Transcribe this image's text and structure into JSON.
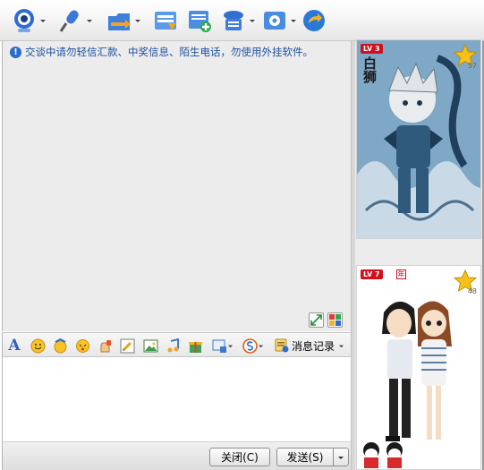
{
  "notice": {
    "text": "交谈中请勿轻信汇款、中奖信息、陌生电话，勿使用外挂软件。"
  },
  "toolbar": {
    "items": [
      {
        "name": "video-call-icon"
      },
      {
        "name": "voice-call-icon"
      },
      {
        "name": "send-file-icon"
      },
      {
        "name": "send-message-icon"
      },
      {
        "name": "create-group-icon"
      },
      {
        "name": "remote-assist-icon"
      },
      {
        "name": "app-settings-icon"
      },
      {
        "name": "share-icon"
      }
    ]
  },
  "format_toolbar": {
    "font_label": "A",
    "message_log_label": "消息记录"
  },
  "buttons": {
    "close_label": "关闭(C)",
    "send_label": "发送(S)"
  },
  "avatars": {
    "top": {
      "level": "LV 3",
      "count": "57",
      "title_glyphs": "白狮"
    },
    "bottom": {
      "level": "LV 7",
      "year": "年",
      "count": "48"
    }
  },
  "colors": {
    "accent": "#2b6cc8",
    "notice_text": "#1e50a0",
    "level_badge": "#d0101e"
  }
}
